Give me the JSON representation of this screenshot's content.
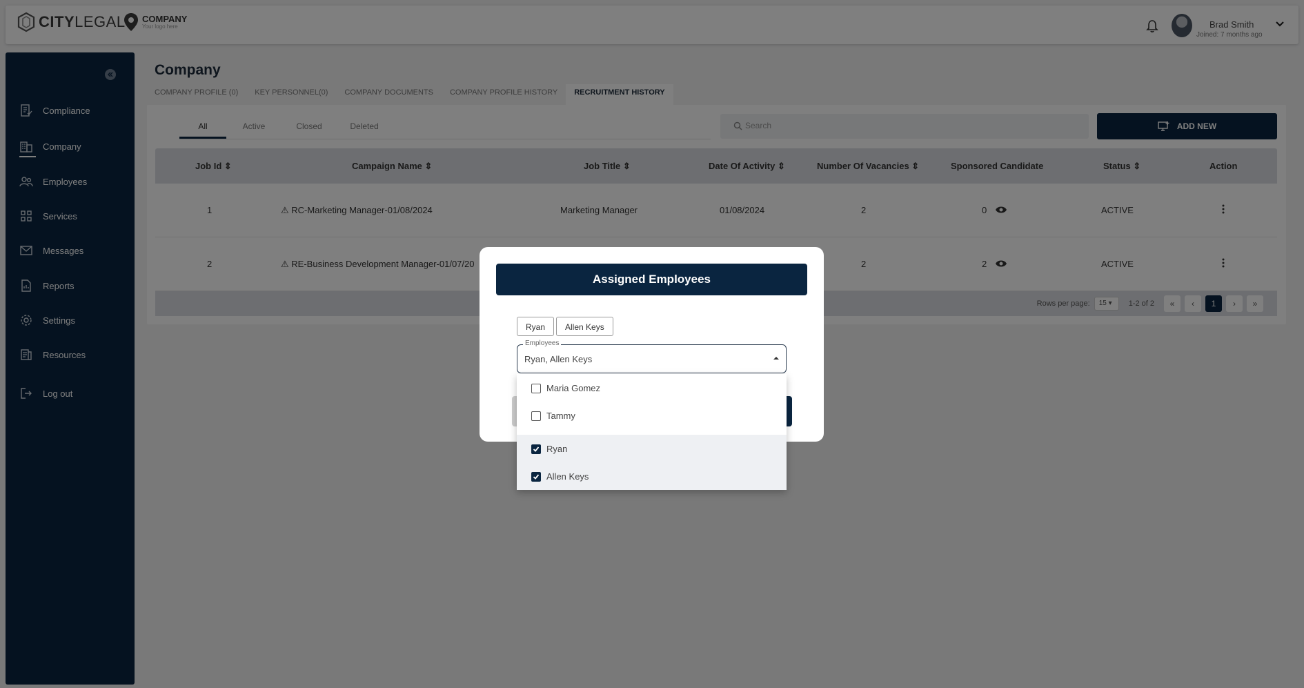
{
  "brand": {
    "logo_word_bold": "CITY",
    "logo_word": "LEGAL",
    "company_name": "COMPANY",
    "company_tagline": "Your logo here"
  },
  "user": {
    "name": "Brad Smith",
    "joined": "Joined: 7 months ago"
  },
  "sidebar": {
    "items": [
      {
        "label": "Compliance",
        "icon": "compliance-icon"
      },
      {
        "label": "Company",
        "icon": "company-icon"
      },
      {
        "label": "Employees",
        "icon": "employees-icon"
      },
      {
        "label": "Services",
        "icon": "services-icon"
      },
      {
        "label": "Messages",
        "icon": "messages-icon"
      },
      {
        "label": "Reports",
        "icon": "reports-icon"
      },
      {
        "label": "Settings",
        "icon": "settings-icon"
      },
      {
        "label": "Resources",
        "icon": "resources-icon"
      },
      {
        "label": "Log out",
        "icon": "logout-icon"
      }
    ]
  },
  "page": {
    "title": "Company",
    "tabs": [
      "COMPANY PROFILE (0)",
      "KEY PERSONNEL(0)",
      "COMPANY DOCUMENTS",
      "COMPANY PROFILE HISTORY",
      "RECRUITMENT HISTORY"
    ],
    "filters": [
      "All",
      "Active",
      "Closed",
      "Deleted"
    ],
    "search_placeholder": "Search",
    "add_new_label": "ADD NEW"
  },
  "table": {
    "columns": [
      "Job Id",
      "Campaign Name",
      "Job Title",
      "Date Of Activity",
      "Number Of Vacancies",
      "Sponsored Candidate",
      "Status",
      "Action"
    ],
    "rows": [
      {
        "job_id": "1",
        "campaign": "RC-Marketing Manager-01/08/2024",
        "job_title": "Marketing Manager",
        "date": "01/08/2024",
        "vacancies": "2",
        "sponsored": "0",
        "status": "ACTIVE"
      },
      {
        "job_id": "2",
        "campaign": "RE-Business Development Manager-01/07/20",
        "job_title": "",
        "date": "",
        "vacancies": "2",
        "sponsored": "2",
        "status": "ACTIVE"
      }
    ],
    "rows_per_page_label": "Rows per page:",
    "rows_per_page": "15",
    "range": "1-2 of 2",
    "current_page": "1"
  },
  "modal": {
    "title": "Assigned Employees",
    "chips": [
      "Ryan",
      "Allen Keys"
    ],
    "field_label": "Employees",
    "field_value": "Ryan, Allen Keys",
    "options": [
      {
        "label": "Maria Gomez",
        "checked": false
      },
      {
        "label": "Tammy",
        "checked": false
      },
      {
        "label": "Ryan",
        "checked": true
      },
      {
        "label": "Allen Keys",
        "checked": true
      }
    ]
  }
}
